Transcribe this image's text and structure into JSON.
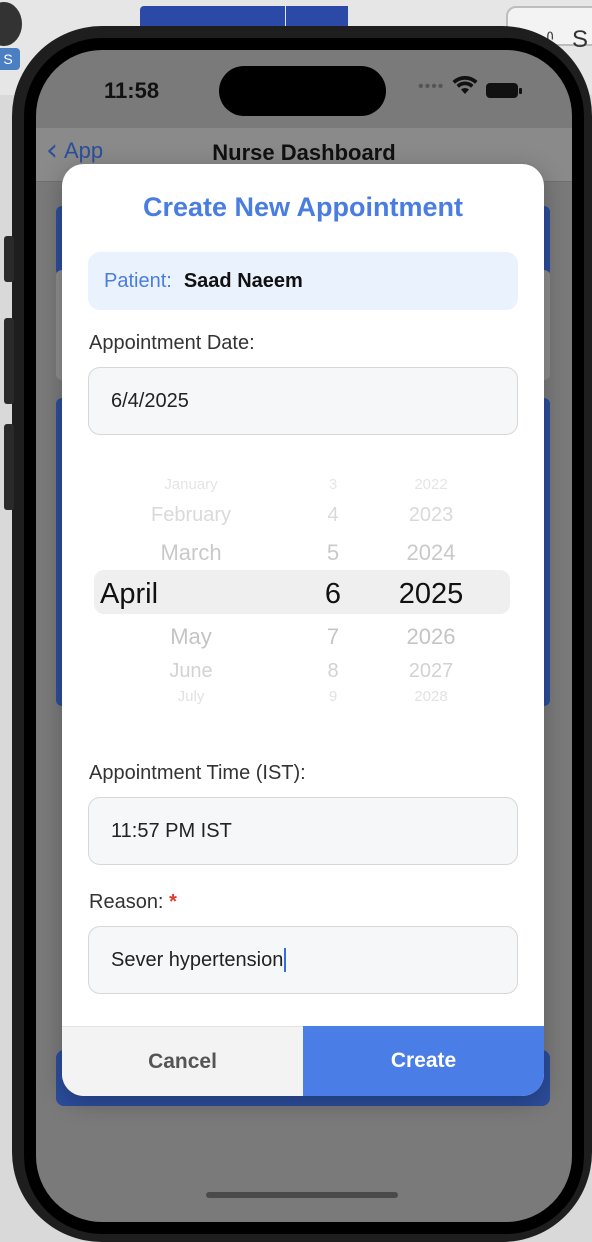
{
  "status_bar": {
    "time": "11:58"
  },
  "desktop": {
    "badge_letter": "S",
    "partial_text": "S"
  },
  "nav": {
    "back_label": "App",
    "title": "Nurse Dashboard"
  },
  "modal": {
    "title": "Create New Appointment",
    "patient_label": "Patient:",
    "patient_name": "Saad Naeem",
    "date_label": "Appointment Date:",
    "date_value": "6/4/2025",
    "picker": {
      "rows": [
        {
          "month": "January",
          "day": "3",
          "year": "2022"
        },
        {
          "month": "February",
          "day": "4",
          "year": "2023"
        },
        {
          "month": "March",
          "day": "5",
          "year": "2024"
        },
        {
          "month": "April",
          "day": "6",
          "year": "2025"
        },
        {
          "month": "May",
          "day": "7",
          "year": "2026"
        },
        {
          "month": "June",
          "day": "8",
          "year": "2027"
        },
        {
          "month": "July",
          "day": "9",
          "year": "2028"
        }
      ],
      "selected_index": 3
    },
    "time_label": "Appointment Time (IST):",
    "time_value": "11:57 PM IST",
    "reason_label": "Reason:",
    "reason_required_mark": "*",
    "reason_value": "Sever hypertension",
    "cancel_label": "Cancel",
    "create_label": "Create"
  },
  "colors": {
    "accent": "#4a7de6",
    "title": "#4a7de0",
    "required": "#e03a2b",
    "dashboard_blue": "#2c4d9c"
  }
}
